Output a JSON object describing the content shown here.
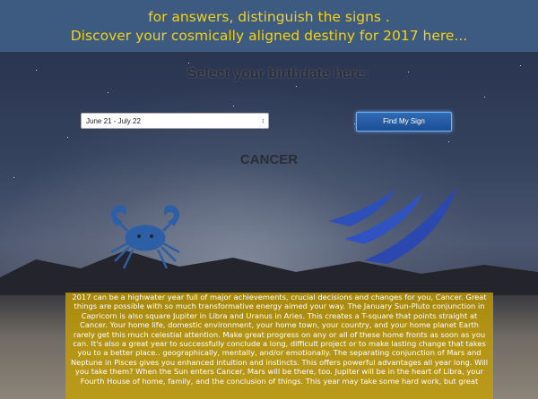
{
  "header": {
    "line1": "for answers, distinguish the signs .",
    "line2": "Discover your cosmically aligned destiny for 2017 here..."
  },
  "form": {
    "prompt": "Select your birthdate here:",
    "selected_range": "June 21 - July 22",
    "button_label": "Find My Sign"
  },
  "sign": {
    "name": "CANCER",
    "symbol_icon": "crab-icon",
    "glyph_icon": "cancer-wave-glyph-icon",
    "symbol_color": "#2d5fa6"
  },
  "horoscope": {
    "text": "2017 can be a highwater year full of major achievements, crucial decisions and changes for you, Cancer. Great things are possible with so much transformative energy aimed your way. The January Sun-Pluto conjunction in Capricorn is also square Jupiter in Libra and Uranus in Aries. This creates a T-square that points straight at Cancer. Your home life, domestic environment, your home town, your country, and your home planet Earth rarely get this much celestial attention. Make great progress on any or all of these home fronts as soon as you can. It's also a great year to successfully conclude a long, difficult project or to make lasting change that takes you to a better place.. geographically, mentally, and/or emotionally. The separating conjunction of Mars and Neptune in Pisces gives you enhanced intuition and instincts. This offers powerful advantages all year long. Will you take them? When the Sun enters Cancer, Mars will be there, too. Jupiter will be in the heart of Libra, your Fourth House of home, family, and the conclusion of things. This year may take some hard work, but great"
  }
}
